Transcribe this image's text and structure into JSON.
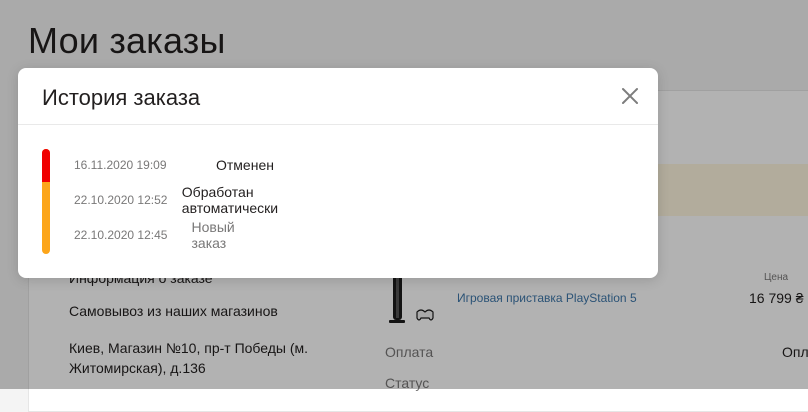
{
  "page": {
    "title": "Мои заказы",
    "info_heading": "Информация о заказе",
    "delivery": "Самовывоз из наших магазинов",
    "address": "Киев, Магазин №10, пр-т Победы (м. Житомирская), д.136",
    "product_name": "Игровая приставка PlayStation 5",
    "price_label": "Цена",
    "price_value": "16 799 ₴",
    "payment_label": "Оплата",
    "payment_value": "Опл",
    "status_label": "Статус"
  },
  "modal": {
    "title": "История заказа",
    "history": [
      {
        "date": "16.11.2020 19:09",
        "status": "Отменен"
      },
      {
        "date": "22.10.2020 12:52",
        "status": "Обработан автоматически"
      },
      {
        "date": "22.10.2020 12:45",
        "status": "Новый заказ"
      }
    ]
  },
  "colors": {
    "canceled": "#f00000",
    "in_progress": "#fca51a",
    "link": "#3e77aa"
  }
}
